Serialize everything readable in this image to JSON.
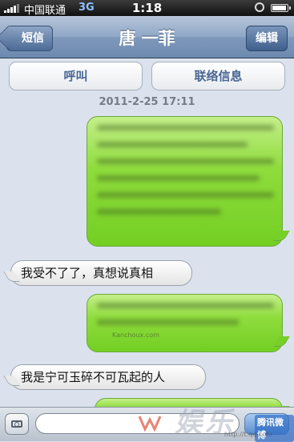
{
  "status_bar": {
    "carrier": "中国联通",
    "network": "3G",
    "time": "1:18"
  },
  "nav": {
    "back_label": "短信",
    "title": "唐 一菲",
    "edit_label": "编辑"
  },
  "actions": {
    "call": "呼叫",
    "contact_info": "联络信息"
  },
  "conversation": {
    "timestamp": "2011-2-25 17:11",
    "messages": [
      {
        "direction": "sent",
        "text": ""
      },
      {
        "direction": "received",
        "text": "我受不了了，真想说真相"
      },
      {
        "direction": "sent",
        "text": ""
      },
      {
        "direction": "received",
        "text": "我是宁可玉碎不可瓦起的人"
      },
      {
        "direction": "sent",
        "text": ""
      }
    ]
  },
  "watermarks": {
    "main": "娱乐",
    "badge": "腾讯微博",
    "url": "http://t.qq.com",
    "small": "Kanchoux.com"
  },
  "colors": {
    "sent_bubble": "#8fdc3d",
    "nav_bar": "#7f99bb",
    "background": "#dbe2ed"
  }
}
